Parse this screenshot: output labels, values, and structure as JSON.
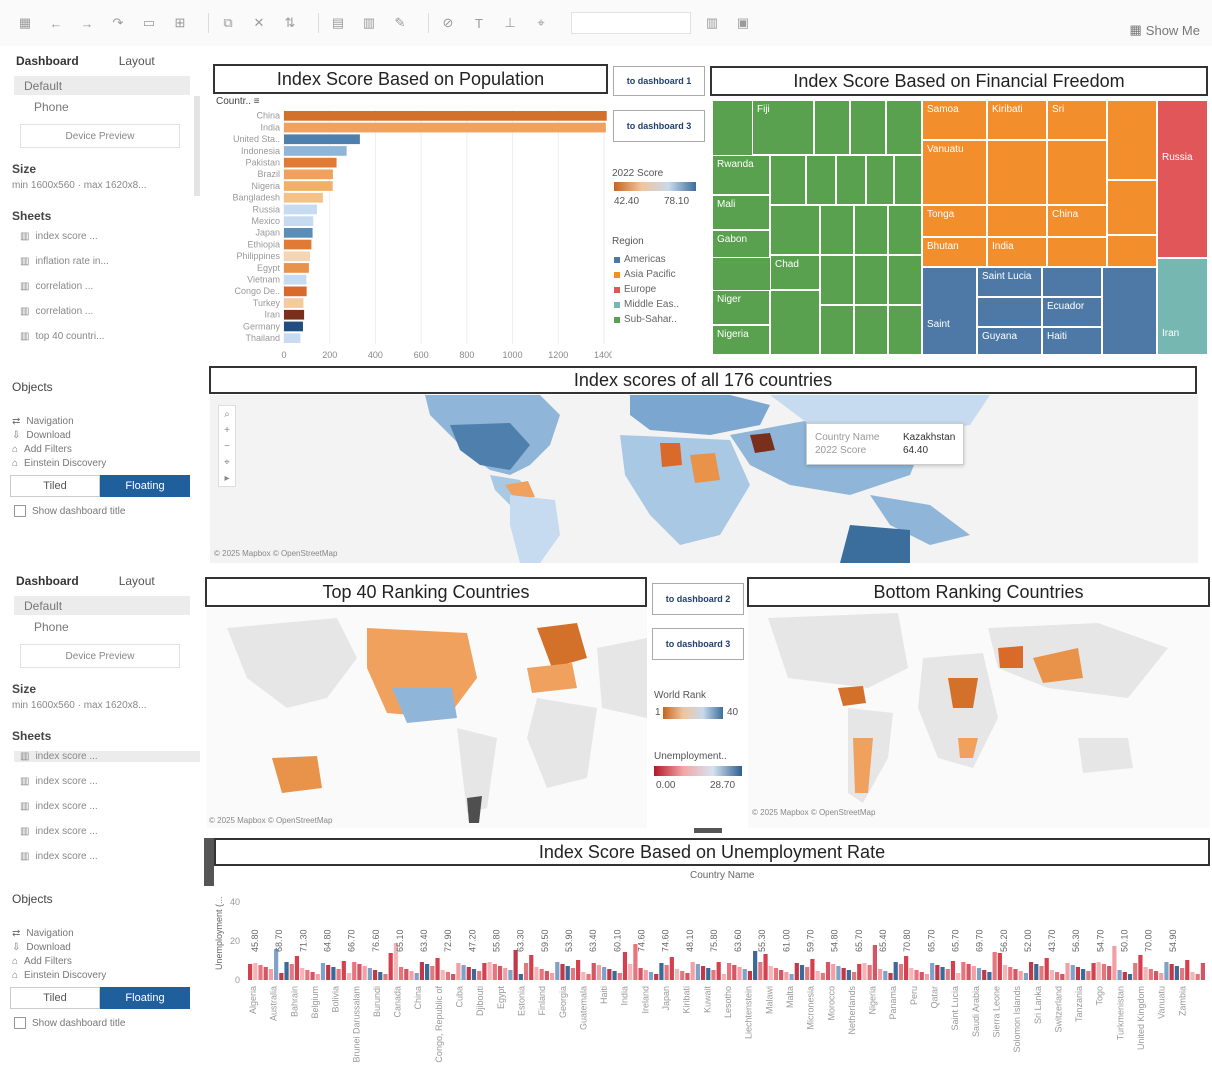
{
  "toolbar": {
    "icons": [
      "grid-icon",
      "back-icon",
      "forward-icon",
      "save-icon",
      "undo-icon",
      "new-sheet-icon",
      "duplicate-icon",
      "clear-icon",
      "swap-icon",
      "sort-asc-icon",
      "sort-desc-icon",
      "highlight-icon",
      "group-icon",
      "label-icon",
      "fix-axes-icon",
      "fit-icon",
      "present-icon"
    ],
    "show_me": "Show Me"
  },
  "panel1": {
    "tab_dashboard": "Dashboard",
    "tab_layout": "Layout",
    "opt_default": "Default",
    "opt_phone": "Phone",
    "device_preview": "Device Preview",
    "size_label": "Size",
    "size_value": "min 1600x560 · max 1620x8...",
    "sheets_label": "Sheets",
    "sheets": [
      "index score ...",
      "inflation rate in...",
      "correlation ...",
      "correlation ...",
      "top 40 countri..."
    ],
    "objects_label": "Objects",
    "objects": [
      "Navigation",
      "Download",
      "Add Filters",
      "Einstein Discovery"
    ],
    "tiled": "Tiled",
    "floating": "Floating",
    "show_title": "Show dashboard title"
  },
  "panel2": {
    "tab_dashboard": "Dashboard",
    "tab_layout": "Layout",
    "opt_default": "Default",
    "opt_phone": "Phone",
    "device_preview": "Device Preview",
    "size_label": "Size",
    "size_value": "min 1600x560 · max 1620x8...",
    "sheets_label": "Sheets",
    "sheets": [
      "index score ...",
      "index score ...",
      "index score ...",
      "index score ...",
      "index score ..."
    ],
    "objects_label": "Objects",
    "objects": [
      "Navigation",
      "Download",
      "Add Filters",
      "Einstein Discovery"
    ],
    "tiled": "Tiled",
    "floating": "Floating",
    "show_title": "Show dashboard title"
  },
  "dash1": {
    "pop_title": "Index Score Based on Population",
    "fin_title": "Index Score Based on Financial Freedom",
    "map_title": "Index scores of all 176 countries",
    "nav1": "to dashboard 1",
    "nav3": "to dashboard 3",
    "country_header": "Countr.. ≡",
    "legend_score_title": "2022 Score",
    "legend_score_min": "42.40",
    "legend_score_max": "78.10",
    "legend_region_title": "Region",
    "regions": [
      "Americas",
      "Asia Pacific",
      "Europe",
      "Middle Eas..",
      "Sub-Sahar.."
    ],
    "region_colors": [
      "#4e79a7",
      "#f28e2b",
      "#e15759",
      "#76b7b2",
      "#59a14f"
    ],
    "tooltip_name_key": "Country Name",
    "tooltip_name_val": "Kazakhstan",
    "tooltip_score_key": "2022 Score",
    "tooltip_score_val": "64.40",
    "map_credit": "© 2025 Mapbox © OpenStreetMap"
  },
  "dash2": {
    "top_title": "Top 40 Ranking Countries",
    "bottom_title": "Bottom Ranking Countries",
    "unemp_title": "Index Score Based on Unemployment Rate",
    "nav2": "to dashboard 2",
    "nav3": "to dashboard 3",
    "legend_rank_title": "World Rank",
    "legend_rank_min": "1",
    "legend_rank_max": "40",
    "legend_unemp_title": "Unemployment..",
    "legend_unemp_min": "0.00",
    "legend_unemp_max": "28.70",
    "credit_left": "© 2025 Mapbox © OpenStreetMap",
    "credit_right": "© 2025 Mapbox © OpenStreetMap",
    "x_axis_title": "Country Name",
    "y_axis_title": "Unemployment (..."
  },
  "chart_data": [
    {
      "type": "bar",
      "title": "Index Score Based on Population",
      "categories": [
        "China",
        "India",
        "United Sta..",
        "Indonesia",
        "Pakistan",
        "Brazil",
        "Nigeria",
        "Bangladesh",
        "Russia",
        "Mexico",
        "Japan",
        "Ethiopia",
        "Philippines",
        "Egypt",
        "Vietnam",
        "Congo De..",
        "Turkey",
        "Iran",
        "Germany",
        "Thailand"
      ],
      "values": [
        1412,
        1408,
        332,
        274,
        230,
        214,
        213,
        170,
        144,
        128,
        125,
        120,
        114,
        109,
        98,
        99,
        85,
        88,
        83,
        72
      ],
      "colors": [
        "#d3702a",
        "#f0a15e",
        "#4f7fad",
        "#8fb6d8",
        "#e07b35",
        "#f0a15e",
        "#f2b066",
        "#f4c187",
        "#c6dbef",
        "#c6dbef",
        "#5b8db9",
        "#e07b35",
        "#f4d6b5",
        "#e8924a",
        "#c6dbef",
        "#d96a2a",
        "#f7c9a1",
        "#7a2e1c",
        "#204e80",
        "#c9dcef"
      ],
      "xticks": [
        "0",
        "200",
        "400",
        "600",
        "800",
        "1000",
        "1200",
        "1400"
      ],
      "xlim": [
        0,
        1400
      ]
    },
    {
      "type": "treemap",
      "title": "Index Score Based on Financial Freedom",
      "labels": [
        "Fiji",
        "Rwanda",
        "Mali",
        "Gabon",
        "Chad",
        "Niger",
        "Nigeria",
        "Samoa",
        "Kiribati",
        "Sri",
        "Vanuatu",
        "Tonga",
        "China",
        "Bhutan",
        "India",
        "Russia",
        "Saint Lucia",
        "Ecuador",
        "Saint",
        "Guyana",
        "Haiti",
        "Iran"
      ]
    },
    {
      "type": "bar",
      "title": "Index Score Based on Unemployment Rate",
      "ylabel": "Unemployment (...",
      "xlabel": "Country Name",
      "yticks": [
        "0",
        "20",
        "40"
      ],
      "ylim": [
        0,
        40
      ],
      "categories": [
        "Algeria",
        "Australia",
        "Bahrain",
        "Belgium",
        "Bolivia",
        "Brunei Darussalam",
        "Burundi",
        "Canada",
        "China",
        "Congo, Republic of",
        "Cuba",
        "Djibouti",
        "Egypt",
        "Estonia",
        "Finland",
        "Georgia",
        "Guatemala",
        "Haiti",
        "India",
        "Ireland",
        "Japan",
        "Kiribati",
        "Kuwait",
        "Lesotho",
        "Liechtenstein",
        "Malawi",
        "Malta",
        "Micronesia",
        "Morocco",
        "Netherlands",
        "Nigeria",
        "Panama",
        "Peru",
        "Qatar",
        "Saint Lucia",
        "Saudi Arabia",
        "Sierra Leone",
        "Solomon Islands",
        "Sri Lanka",
        "Switzerland",
        "Tanzania",
        "Togo",
        "Turkmenistan",
        "United Kingdom",
        "Vanuatu",
        "Zambia"
      ],
      "data_labels": [
        "45.80",
        "68.70",
        "71.30",
        "64.80",
        "66.70",
        "76.60",
        "65.10",
        "63.40",
        "72.90",
        "47.20",
        "55.80",
        "63.30",
        "59.50",
        "53.90",
        "63.40",
        "60.10",
        "74.60",
        "74.60",
        "48.10",
        "75.80",
        "63.60",
        "55.30",
        "61.00",
        "59.70",
        "54.80",
        "65.70",
        "65.40",
        "70.80",
        "65.70",
        "65.70",
        "69.70",
        "56.20",
        "52.00",
        "43.70",
        "56.30",
        "54.70",
        "50.10",
        "70.00",
        "54.90"
      ]
    }
  ]
}
